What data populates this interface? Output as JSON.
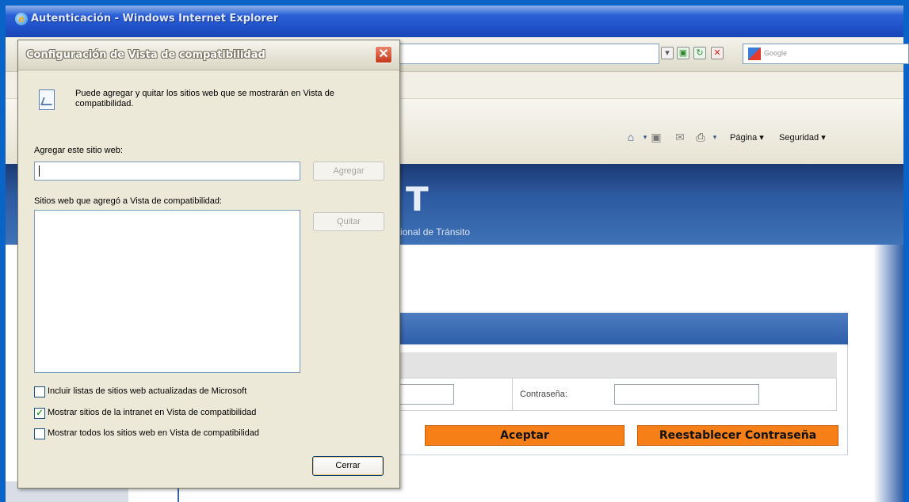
{
  "window": {
    "title": "Autenticación - Windows Internet Explorer",
    "search_placeholder": "Google"
  },
  "command_bar": {
    "page_label": "Página ▾",
    "security_label": "Seguridad ▾"
  },
  "page": {
    "banner_subtitle": "cional de Tránsito",
    "password_label": "Contraseña:",
    "accept_button": "Aceptar",
    "reset_button": "Reestablecer Contraseña"
  },
  "dialog": {
    "title": "Configuración de Vista de compatibilidad",
    "info_text": "Puede agregar y quitar los sitios web que se mostrarán en Vista de compatibilidad.",
    "add_site_label": "Agregar este sitio web:",
    "add_site_value": "",
    "add_button": "Agregar",
    "list_label": "Sitios web que agregó a Vista de compatibilidad:",
    "remove_button": "Quitar",
    "checkboxes": [
      {
        "label": "Incluir listas de sitios web actualizadas de Microsoft",
        "checked": false
      },
      {
        "label": "Mostrar sitios de la intranet en Vista de compatibilidad",
        "checked": true
      },
      {
        "label": "Mostrar todos los sitios web en Vista de compatibilidad",
        "checked": false
      }
    ],
    "close_button": "Cerrar"
  },
  "colors": {
    "frame_blue": "#0a64c8",
    "accent_orange": "#f67f18",
    "dialog_bg": "#ece9d8"
  }
}
